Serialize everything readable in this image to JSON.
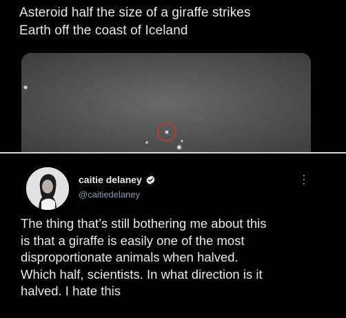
{
  "headline": {
    "lines": [
      "Asteroid half the size of a giraffe strikes",
      "Earth off the coast of Iceland"
    ]
  },
  "news_image": {
    "subject": "asteroid-photo",
    "circle_color": "#c0392b"
  },
  "tweet": {
    "display_name": "caitie delaney",
    "handle": "@caitiedelaney",
    "verified": true,
    "body_lines": [
      "The thing that’s still bothering me about this",
      "is that a giraffe is easily one of the most",
      "disproportionate animals when halved.",
      "Which half, scientists. In what direction is it",
      "halved. I hate this"
    ]
  },
  "colors": {
    "background": "#000000",
    "text": "#e7e9ea",
    "handle": "#8b98a5",
    "divider": "#d9d9d9"
  }
}
